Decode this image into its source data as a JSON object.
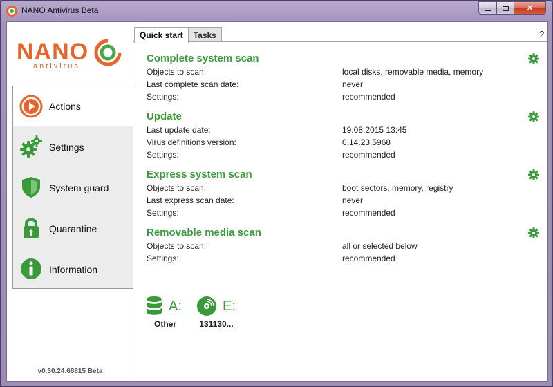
{
  "window": {
    "title": "NANO Antivirus Beta"
  },
  "logo": {
    "word": "NANO",
    "sub": "antivirus"
  },
  "sidebar": {
    "items": [
      {
        "label": "Actions"
      },
      {
        "label": "Settings"
      },
      {
        "label": "System guard"
      },
      {
        "label": "Quarantine"
      },
      {
        "label": "Information"
      }
    ],
    "version": "v0.30.24.68615 Beta"
  },
  "tabs": [
    {
      "label": "Quick start"
    },
    {
      "label": "Tasks"
    }
  ],
  "help_label": "?",
  "sections": [
    {
      "title": "Complete system scan",
      "rows": [
        {
          "key": "Objects to scan:",
          "value": "local disks, removable media, memory"
        },
        {
          "key": "Last complete scan date:",
          "value": "never"
        },
        {
          "key": "Settings:",
          "value": "recommended"
        }
      ]
    },
    {
      "title": "Update",
      "rows": [
        {
          "key": "Last update date:",
          "value": "19.08.2015 13:45"
        },
        {
          "key": "Virus definitions version:",
          "value": "0.14.23.5968"
        },
        {
          "key": "Settings:",
          "value": "recommended"
        }
      ]
    },
    {
      "title": "Express system scan",
      "rows": [
        {
          "key": "Objects to scan:",
          "value": "boot sectors, memory, registry"
        },
        {
          "key": "Last express scan date:",
          "value": "never"
        },
        {
          "key": "Settings:",
          "value": "recommended"
        }
      ]
    },
    {
      "title": "Removable media scan",
      "rows": [
        {
          "key": "Objects to scan:",
          "value": "all or selected below"
        },
        {
          "key": "Settings:",
          "value": "recommended"
        }
      ]
    }
  ],
  "drives": [
    {
      "letter": "A:",
      "name": "Other",
      "icon": "database-icon"
    },
    {
      "letter": "E:",
      "name": "131130...",
      "icon": "disc-icon"
    }
  ],
  "colors": {
    "accent_green": "#3a9a3a",
    "brand_orange": "#e8642a"
  }
}
